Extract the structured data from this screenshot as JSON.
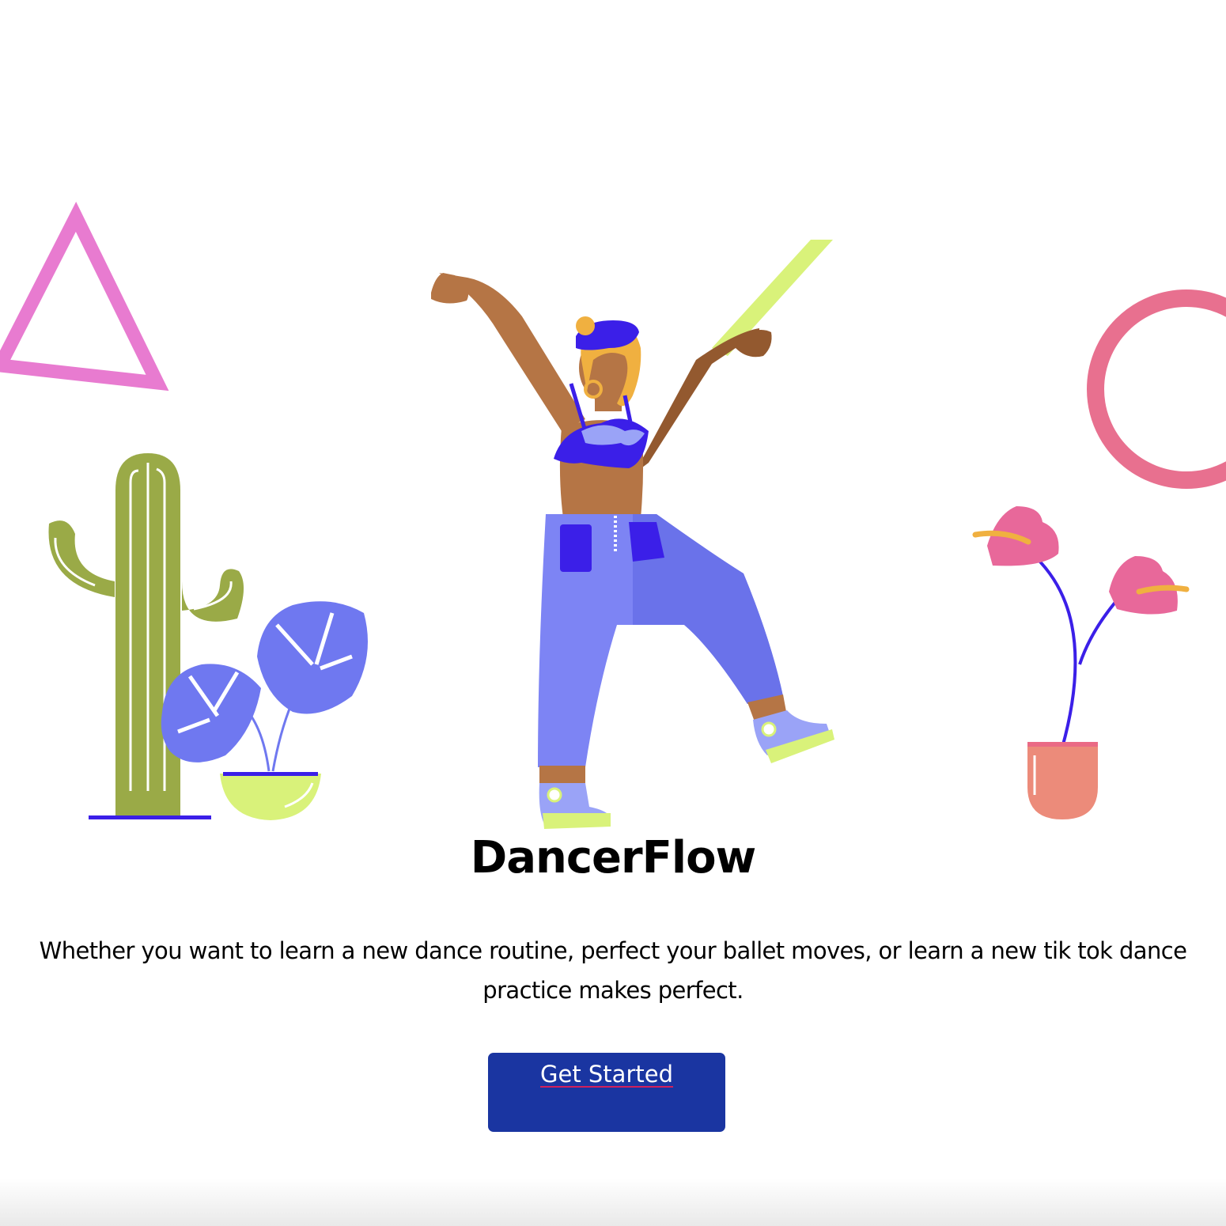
{
  "app": {
    "title": "DancerFlow",
    "tagline": "Whether you want to learn a new dance routine, perfect your ballet moves, or learn a new tik tok dance practice makes perfect.",
    "cta_label": "Get Started"
  },
  "colors": {
    "cta_background": "#1a35a1",
    "cta_text": "#ffffff",
    "triangle": "#e87bd0",
    "ring": "#e8708f",
    "stripe": "#d9f27a",
    "cactus": "#9aaa47",
    "monstera": "#6f78f0",
    "anthurium": "#e8689a",
    "skin": "#b57545",
    "top": "#3b1fe8",
    "pants": "#7d84f4"
  },
  "illustration": {
    "elements": [
      "triangle-shape",
      "ring-shape",
      "stripe-shape",
      "cactus",
      "monstera-plant",
      "dancer-figure",
      "anthurium-plant"
    ]
  }
}
